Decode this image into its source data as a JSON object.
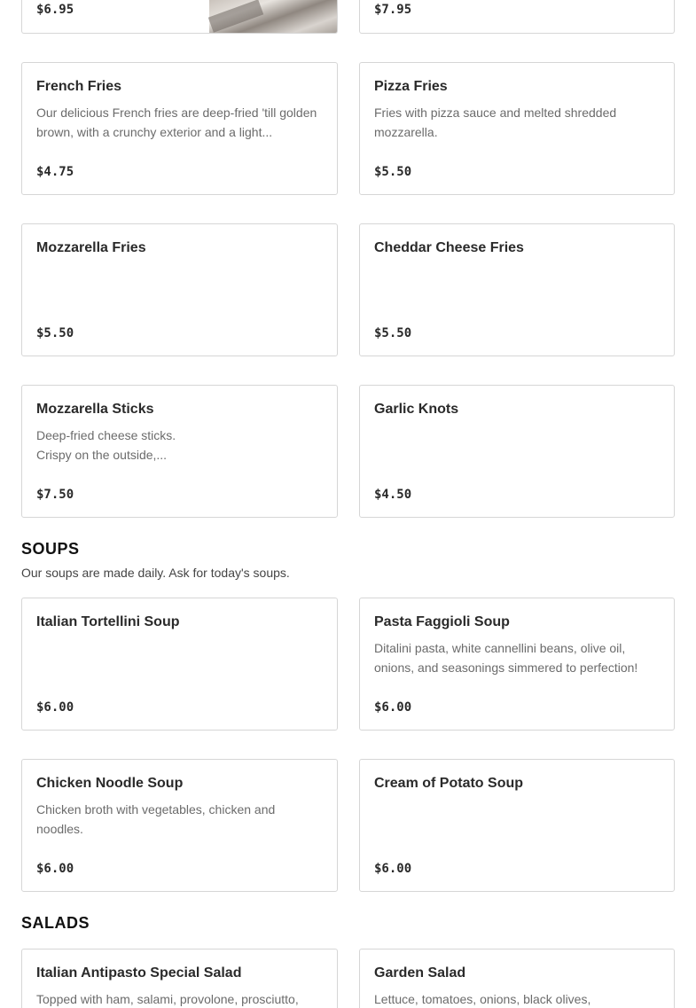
{
  "top_row": {
    "left_price": "$6.95",
    "right_price": "$7.95"
  },
  "appetizers": [
    {
      "name": "French Fries",
      "desc": "Our delicious French fries are deep-fried 'till golden brown, with a crunchy exterior and a light...",
      "price": "$4.75"
    },
    {
      "name": "Pizza Fries",
      "desc": "Fries with pizza sauce and melted shredded mozzarella.",
      "price": "$5.50"
    },
    {
      "name": "Mozzarella Fries",
      "desc": "",
      "price": "$5.50"
    },
    {
      "name": "Cheddar Cheese Fries",
      "desc": "",
      "price": "$5.50"
    },
    {
      "name": "Mozzarella Sticks",
      "desc": "Deep-fried cheese sticks.\nCrispy on the outside,...",
      "price": "$7.50"
    },
    {
      "name": "Garlic Knots",
      "desc": "",
      "price": "$4.50"
    }
  ],
  "soups": {
    "title": "SOUPS",
    "description": "Our soups are made daily. Ask for today's soups.",
    "items": [
      {
        "name": "Italian Tortellini Soup",
        "desc": "",
        "price": "$6.00"
      },
      {
        "name": "Pasta Faggioli Soup",
        "desc": "Ditalini pasta, white cannellini beans, olive oil, onions, and seasonings simmered to perfection!",
        "price": "$6.00"
      },
      {
        "name": "Chicken Noodle Soup",
        "desc": "Chicken broth with vegetables, chicken and noodles.",
        "price": "$6.00"
      },
      {
        "name": "Cream of Potato Soup",
        "desc": "",
        "price": "$6.00"
      }
    ]
  },
  "salads": {
    "title": "SALADS",
    "items": [
      {
        "name": "Italian Antipasto Special Salad",
        "desc": "Topped with ham, salami, provolone, prosciutto,"
      },
      {
        "name": "Garden Salad",
        "desc": "Lettuce, tomatoes, onions, black olives,"
      }
    ]
  }
}
